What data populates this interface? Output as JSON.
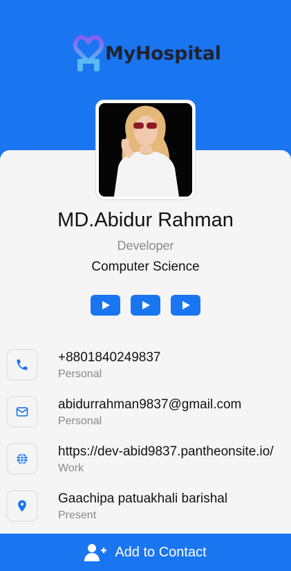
{
  "brand": {
    "name": "MyHospital",
    "accent": "#1a75f0",
    "logo_gradient": [
      "#7b5cf0",
      "#4db8f0"
    ]
  },
  "profile": {
    "photo_icon": "profile-photo",
    "name": "MD.Abidur Rahman",
    "role": "Developer",
    "department": "Computer Science"
  },
  "social": [
    {
      "icon": "youtube-play-icon"
    },
    {
      "icon": "youtube-play-icon"
    },
    {
      "icon": "youtube-play-icon"
    }
  ],
  "contacts": [
    {
      "icon": "phone-icon",
      "value": "+8801840249837",
      "label": "Personal"
    },
    {
      "icon": "email-icon",
      "value": "abidurrahman9837@gmail.com",
      "label": "Personal"
    },
    {
      "icon": "globe-icon",
      "value": "https://dev-abid9837.pantheonsite.io/",
      "label": "Work"
    },
    {
      "icon": "location-pin-icon",
      "value": "Gaachipa patuakhali barishal",
      "label": "Present"
    }
  ],
  "cta": {
    "icon": "add-user-icon",
    "label": "Add to Contact"
  }
}
